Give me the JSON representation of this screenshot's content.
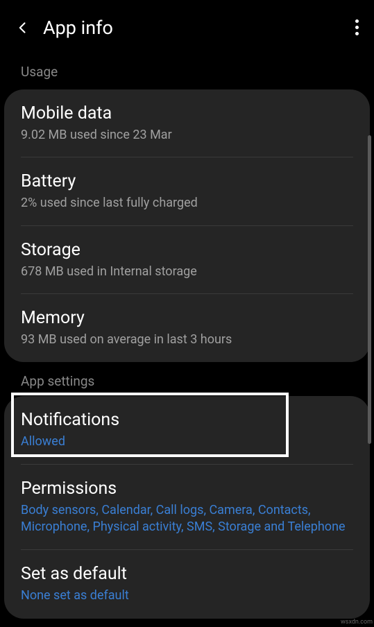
{
  "header": {
    "title": "App info"
  },
  "sections": {
    "usage": {
      "label": "Usage",
      "items": [
        {
          "title": "Mobile data",
          "subtitle": "9.02 MB used since 23 Mar"
        },
        {
          "title": "Battery",
          "subtitle": "2% used since last fully charged"
        },
        {
          "title": "Storage",
          "subtitle": "678 MB used in Internal storage"
        },
        {
          "title": "Memory",
          "subtitle": "93 MB used on average in last 3 hours"
        }
      ]
    },
    "appSettings": {
      "label": "App settings",
      "items": [
        {
          "title": "Notifications",
          "subtitle": "Allowed"
        },
        {
          "title": "Permissions",
          "subtitle": "Body sensors, Calendar, Call logs, Camera, Contacts, Microphone, Physical activity, SMS, Storage and Telephone"
        },
        {
          "title": "Set as default",
          "subtitle": "None set as default"
        }
      ]
    }
  },
  "watermark": "wsxdn.com"
}
